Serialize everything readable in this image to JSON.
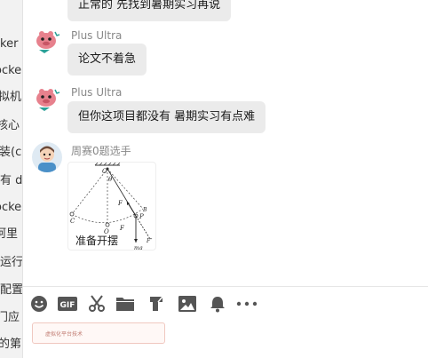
{
  "sidebar": {
    "items": [
      {
        "label": "ker"
      },
      {
        "label": "ocker"
      },
      {
        "label": "拟机"
      },
      {
        "label": "核心"
      },
      {
        "label": "装(c"
      },
      {
        "label": "有 d"
      },
      {
        "label": "ocker"
      },
      {
        "label": "阿里"
      },
      {
        "label": " 运行"
      },
      {
        "label": "配置"
      },
      {
        "label": "门应"
      },
      {
        "label": " 的第"
      }
    ]
  },
  "chat": {
    "messages": [
      {
        "sender": "",
        "text": "正常的 先找到暑期实习再说"
      },
      {
        "sender": "Plus Ultra",
        "text": "论文不着急"
      },
      {
        "sender": "Plus Ultra",
        "text": "但你这项目都没有  暑期实习有点难"
      },
      {
        "sender": "周赛0题选手",
        "image_caption": "准备开摆"
      }
    ],
    "diagram_labels": {
      "o_prime": "O′",
      "theta": "θ",
      "f_upper": "F",
      "b": "B",
      "p": "P",
      "c": "C",
      "o": "O",
      "f_lower": "F",
      "f_double_prime": "F″",
      "mg": "mg"
    }
  },
  "toolbar": {
    "tools": [
      "emoji-icon",
      "gif-icon",
      "scissors-icon",
      "folder-icon",
      "file-transfer-icon",
      "image-icon",
      "bell-icon",
      "more-icon"
    ]
  },
  "input": {
    "preview_text": "虚拟化平台技术"
  },
  "colors": {
    "bubble": "#ebebeb",
    "sender": "#888888",
    "icon": "#555555"
  }
}
